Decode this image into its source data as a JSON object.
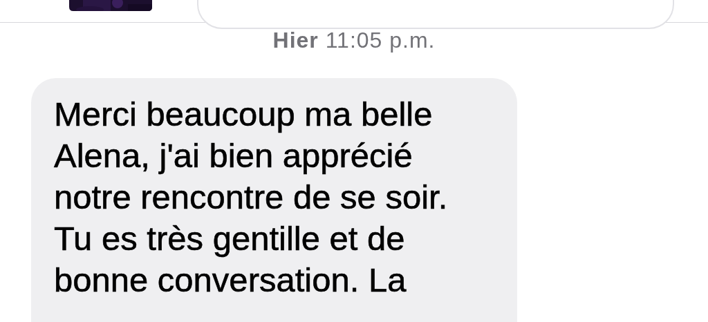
{
  "timestamp": "**Hier** 11:05 p.m.",
  "messages": [
    {
      "kind": "incoming",
      "lines": [
        "Merci beaucoup ma belle",
        "Alena, j'ai bien apprécié",
        "notre rencontre de se soir.",
        "Tu es très gentille et de",
        "bonne conversation. La"
      ]
    }
  ]
}
